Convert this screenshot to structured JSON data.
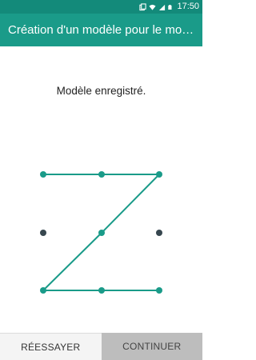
{
  "status_bar": {
    "time": "17:50",
    "icons": [
      "sync-icon",
      "wifi-icon",
      "signal-icon",
      "battery-icon"
    ],
    "color": "#138a7a"
  },
  "app_bar": {
    "title": "Création d'un modèle pour le mode P…",
    "color": "#1a9b89"
  },
  "message": "Modèle enregistré.",
  "pattern": {
    "active_color": "#1a9b89",
    "inactive_color": "#37474f",
    "dots": [
      {
        "row": 0,
        "col": 0,
        "active": true
      },
      {
        "row": 0,
        "col": 1,
        "active": true
      },
      {
        "row": 0,
        "col": 2,
        "active": true
      },
      {
        "row": 1,
        "col": 0,
        "active": false
      },
      {
        "row": 1,
        "col": 1,
        "active": true
      },
      {
        "row": 1,
        "col": 2,
        "active": false
      },
      {
        "row": 2,
        "col": 0,
        "active": true
      },
      {
        "row": 2,
        "col": 1,
        "active": true
      },
      {
        "row": 2,
        "col": 2,
        "active": true
      }
    ],
    "path": [
      {
        "row": 0,
        "col": 0
      },
      {
        "row": 0,
        "col": 1
      },
      {
        "row": 0,
        "col": 2
      },
      {
        "row": 1,
        "col": 1
      },
      {
        "row": 2,
        "col": 0
      },
      {
        "row": 2,
        "col": 1
      },
      {
        "row": 2,
        "col": 2
      }
    ]
  },
  "buttons": {
    "retry": "RÉESSAYER",
    "continue": "CONTINUER"
  }
}
